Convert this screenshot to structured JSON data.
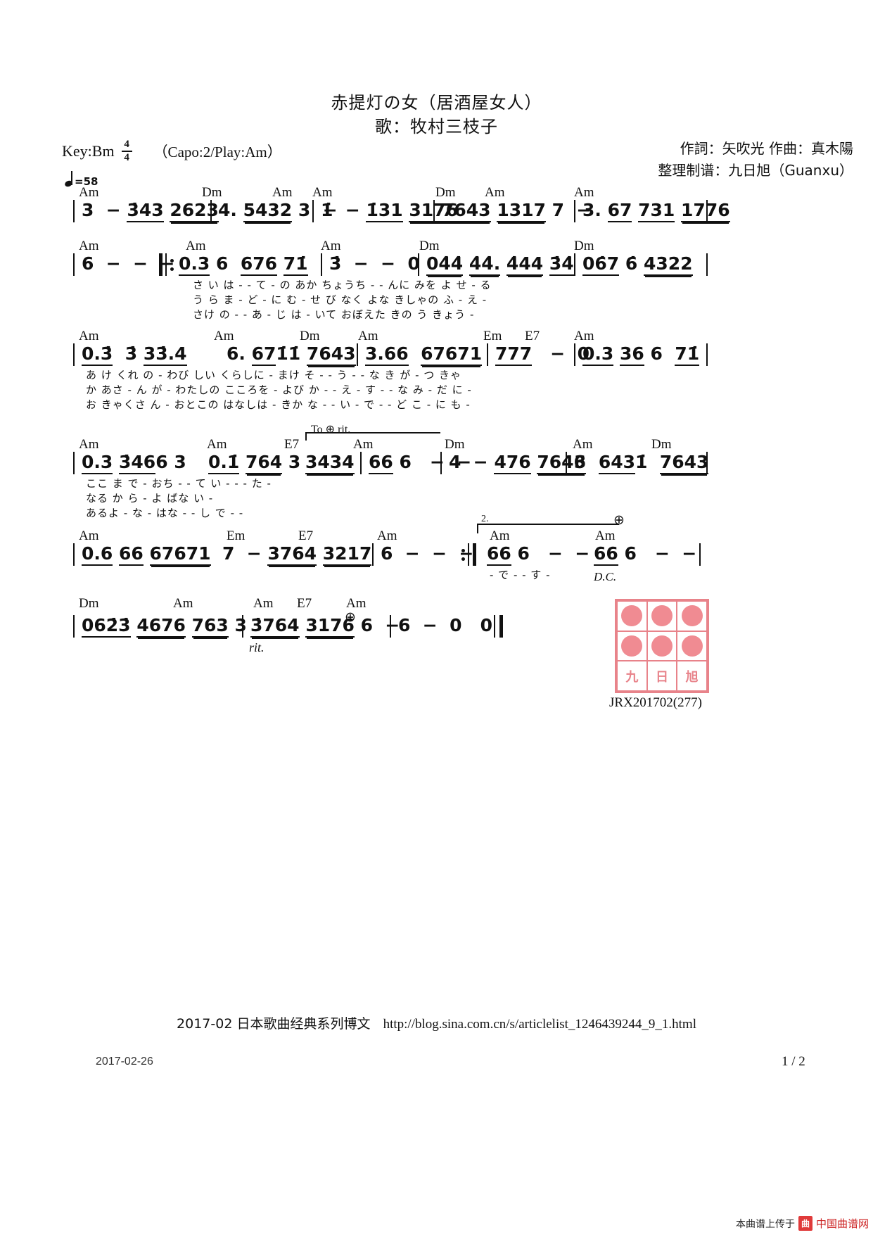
{
  "header": {
    "title": "赤提灯の女（居酒屋女人）",
    "singer": "歌：牧村三枝子",
    "key_label": "Key:Bm",
    "time_sig_top": "4",
    "time_sig_bottom": "4",
    "capo": "（Capo:2/Play:Am）",
    "lyricist_composer": "作詞：矢吹光  作曲：真木陽",
    "arranger": "整理制谱：九日旭（Guanxu）",
    "tempo_value": "=58"
  },
  "systems": [
    {
      "id": "system-1",
      "chords": [
        "Am",
        "Dm",
        "Am",
        "Am",
        "Dm",
        "Am",
        "Am"
      ],
      "notes": "| 3 - 343 2623 | 4. 5432 3 - | 1 - 131 3176 | 7643 1317 7 - | 3. 67 731 1776 |",
      "lyrics": []
    },
    {
      "id": "system-2",
      "chords": [
        "Am",
        "Am",
        "Am",
        "Dm",
        "Dm"
      ],
      "notes": "| 6 - - - ‖: 0.3 6 676 71 | 3 - - 0 | 044 44. 444 34 | 067 6 4322 |",
      "lyrics": [
        "さ い は - - て - の            あか ちょうち - - んに    みを よ せ - る",
        "う ら ま - ど - に            む - せ び  なく よな    きしゃの ふ - え -",
        "さけ の - - あ - じ            は - いて  おぼえた     きの う きょう -"
      ]
    },
    {
      "id": "system-3",
      "chords": [
        "Am",
        "Am",
        "Dm",
        "Am",
        "Em",
        "E7",
        "Am"
      ],
      "notes": "| 0.3 3 33.4 | 6. 671 1 7643 | 3.66 67671 | 777 - 0 | 0.3 36 6 71 |",
      "lyrics": [
        "あ け くれ の - わび しい くらしに - まけ そ - - う - - な            き が - つ きゃ",
        "か あさ - ん が - わたしの こころを - よび か - - え - す - -            な み - だ に -",
        "お きゃくさ ん - おとこの はなしは - きか な - - い - で - -            ど こ - に も -"
      ]
    },
    {
      "id": "system-4",
      "chords": [
        "Am",
        "Am",
        "E7",
        "Am",
        "Dm",
        "Am",
        "Dm"
      ],
      "notes": "| 0.3 3466 3 | 0.1 7643 | 3434 | 666 - - | 4 - 476 7646 | 3 6431 | 7643 |",
      "tag": "To ⊕ rit.",
      "lyrics": [
        "ここ ま で - おち - - て い - - - た -",
        "なる か ら - よ ばな い -",
        "あるよ - な - はな - - し で - -"
      ]
    },
    {
      "id": "system-5",
      "chords": [
        "Am",
        "Em",
        "E7",
        "Am",
        "Am",
        "Am"
      ],
      "notes": "| 0.6 66 67671 | 7 - 3764 3217 | 6 - - - :‖ 666 - - | 666 - - |",
      "ending_label": "2.",
      "dc_label": "D.C.",
      "lyrics": [
        "- で -                - す -"
      ]
    },
    {
      "id": "system-6",
      "chords": [
        "Dm",
        "Am",
        "Am",
        "E7",
        "Am"
      ],
      "notes": "| 0623 4676 7633 | 3764 3176 6 - | 6 - 0 0 ‖",
      "rit_label": "rit.",
      "coda_label": "⊕"
    }
  ],
  "seal": {
    "characters": [
      "九",
      "日",
      "旭"
    ],
    "code": "JRX201702(277)",
    "color": "#e8838a"
  },
  "footer": {
    "blog_text": "2017-02 日本歌曲经典系列博文",
    "blog_url": "http://blog.sina.com.cn/s/articlelist_1246439244_9_1.html",
    "date": "2017-02-26",
    "page": "1 / 2",
    "upload_text": "本曲谱上传于",
    "site_name": "中国曲谱网",
    "site_badge": "曲"
  }
}
